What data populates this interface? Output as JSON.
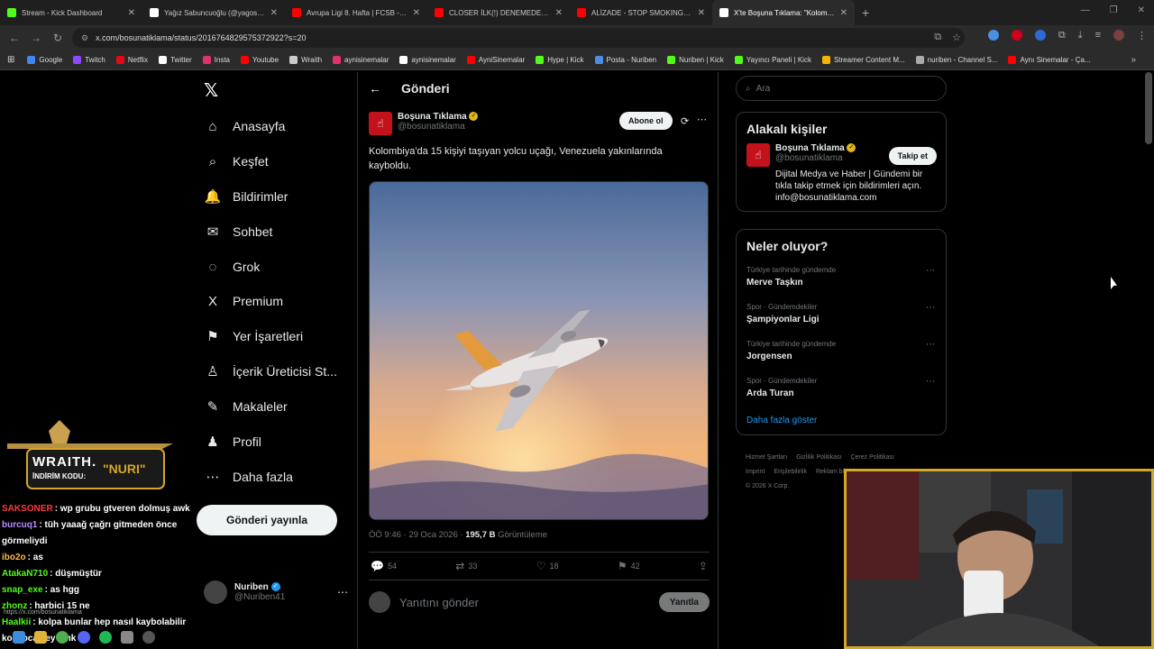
{
  "browser": {
    "tabs": [
      {
        "title": "Stream - Kick Dashboard",
        "color": "#53fc18"
      },
      {
        "title": "Yağız Sabuncuoğlu (@yagosab…",
        "color": "#ffffff"
      },
      {
        "title": "Avrupa Ligi 8. Hafta | FCSB - Fe…",
        "color": "#ff0000"
      },
      {
        "title": "CLOSER İLK(!) DENEMEDE BAŞA…",
        "color": "#ff0000"
      },
      {
        "title": "ALİZADE - STOP SMOKING (Of…",
        "color": "#ff0000"
      },
      {
        "title": "X'te Boşuna Tıklama: \"Kolombiy…",
        "color": "#ffffff"
      }
    ],
    "active_tab": 5,
    "url": "x.com/bosunatiklama/status/2016764829575372922?s=20",
    "bookmarks": [
      {
        "label": "Google",
        "color": "#4285f4"
      },
      {
        "label": "Twitch",
        "color": "#9146ff"
      },
      {
        "label": "Netflix",
        "color": "#e50914"
      },
      {
        "label": "Twitter",
        "color": "#ffffff"
      },
      {
        "label": "Insta",
        "color": "#e1306c"
      },
      {
        "label": "Youtube",
        "color": "#ff0000"
      },
      {
        "label": "Wraith",
        "color": "#cccccc"
      },
      {
        "label": "aynisinemalar",
        "color": "#e1306c"
      },
      {
        "label": "aynisinemalar",
        "color": "#ffffff"
      },
      {
        "label": "AyniSinemalar",
        "color": "#ff0000"
      },
      {
        "label": "Hype | Kick",
        "color": "#53fc18"
      },
      {
        "label": "Posta - Nuriben",
        "color": "#4a90e2"
      },
      {
        "label": "Nuriben | Kick",
        "color": "#53fc18"
      },
      {
        "label": "Yayıncı Paneli | Kick",
        "color": "#53fc18"
      },
      {
        "label": "Streamer Content M...",
        "color": "#f4b400"
      },
      {
        "label": "nuriben - Channel S...",
        "color": "#aaaaaa"
      },
      {
        "label": "Aynı Sinemalar - Ça...",
        "color": "#ff0000"
      }
    ]
  },
  "nav": {
    "items": [
      {
        "label": "Anasayfa",
        "icon": "⌂"
      },
      {
        "label": "Keşfet",
        "icon": "⌕"
      },
      {
        "label": "Bildirimler",
        "icon": "🔔"
      },
      {
        "label": "Sohbet",
        "icon": "✉"
      },
      {
        "label": "Grok",
        "icon": "◌"
      },
      {
        "label": "Premium",
        "icon": "X"
      },
      {
        "label": "Yer İşaretleri",
        "icon": "⚑"
      },
      {
        "label": "İçerik Üreticisi St...",
        "icon": "♙"
      },
      {
        "label": "Makaleler",
        "icon": "✎"
      },
      {
        "label": "Profil",
        "icon": "♟"
      },
      {
        "label": "Daha fazla",
        "icon": "⋯"
      }
    ],
    "post_button": "Gönderi yayınla",
    "account": {
      "name": "Nuriben",
      "handle": "@Nuriben41"
    }
  },
  "post": {
    "header": "Gönderi",
    "author_name": "Boşuna Tıklama",
    "author_handle": "@bosunatiklama",
    "subscribe_label": "Abone ol",
    "text": "Kolombiya'da 15 kişiyi taşıyan yolcu uçağı, Venezuela yakınlarında kayboldu.",
    "time": "ÖÖ 9:46 · 29 Oca 2026 · ",
    "views": "195,7 B",
    "views_label": " Görüntüleme",
    "replies": "54",
    "reposts": "33",
    "likes": "18",
    "bookmarks": "42",
    "reply_placeholder": "Yanıtını gönder",
    "reply_button": "Yanıtla"
  },
  "sidebar": {
    "search_placeholder": "Ara",
    "related_title": "Alakalı kişiler",
    "related": {
      "name": "Boşuna Tıklama",
      "handle": "@bosunatiklama",
      "bio": "Dijital Medya ve Haber | Gündemi bir tıkla takip etmek için bildirimleri açın. info@bosunatiklama.com",
      "follow_label": "Takip et"
    },
    "trends_title": "Neler oluyor?",
    "trends": [
      {
        "category": "Türkiye tarihinde gündemde",
        "title": "Merve Taşkın"
      },
      {
        "category": "Spor · Gündemdekiler",
        "title": "Şampiyonlar Ligi"
      },
      {
        "category": "Türkiye tarihinde gündemde",
        "title": "Jorgensen"
      },
      {
        "category": "Spor · Gündemdekiler",
        "title": "Arda Turan"
      }
    ],
    "show_more": "Daha fazla göster",
    "footer": [
      "Hizmet Şartları",
      "Gizlilik Politikası",
      "Çerez Politikası",
      "Imprint",
      "Erişilebilirlik",
      "Reklam bilgisi"
    ],
    "copyright": "© 2026 X Corp."
  },
  "stream": {
    "wraith_title": "WRAITH.",
    "wraith_code_label": "İNDİRİM KODU:",
    "wraith_code": "NURI",
    "chat": [
      {
        "user": "SAKSONER",
        "color": "#ff3b3b",
        "msg": ": wp grubu gtveren dolmuş awk"
      },
      {
        "user": "burcuq1",
        "color": "#b58cff",
        "msg": ": tüh yaaağ çağrı gitmeden önce görmeliydi"
      },
      {
        "user": "ibo2o",
        "color": "#ffb84d",
        "msg": ": as"
      },
      {
        "user": "AtakaN710",
        "color": "#53fc18",
        "msg": ": düşmüştür"
      },
      {
        "user": "snap_exe",
        "color": "#53fc18",
        "msg": ": as hgg"
      },
      {
        "user": "zhonz",
        "color": "#53fc18",
        "msg": ": harbici 15 ne"
      },
      {
        "user": "Haalkii",
        "color": "#53fc18",
        "msg": ": kolpa bunlar hep nasıl kaybolabilir koskoca şey amk"
      }
    ],
    "status_url": "https://x.com/bosunatiklama"
  }
}
